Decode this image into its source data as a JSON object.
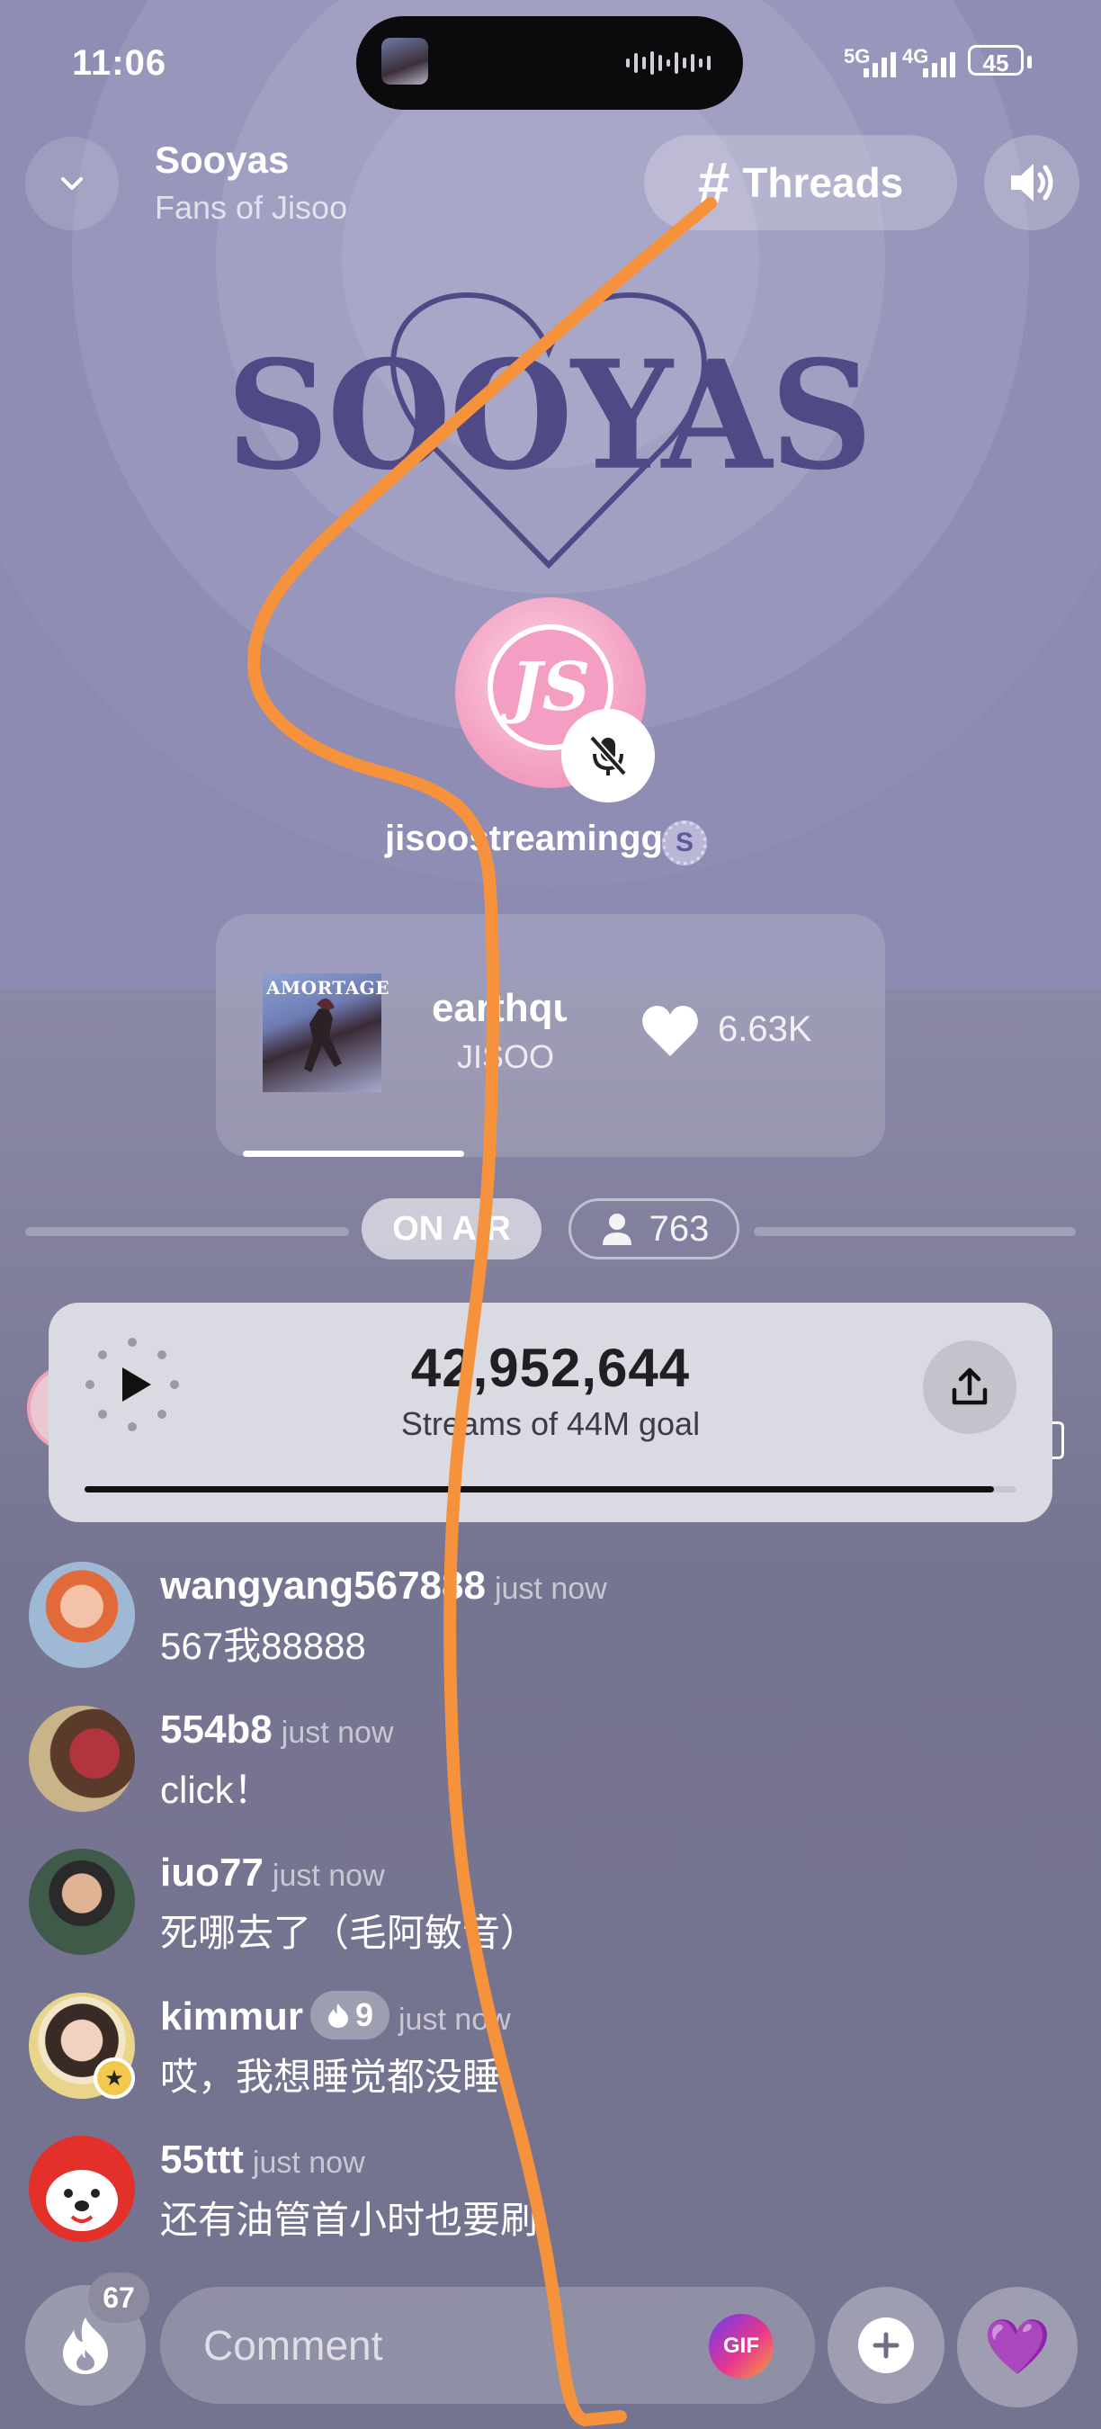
{
  "status_bar": {
    "time": "11:06",
    "net_5g": "5G",
    "net_4g": "4G",
    "battery": "45"
  },
  "header": {
    "title": "Sooyas",
    "subtitle": "Fans of Jisoo",
    "threads_label": "Threads",
    "back_icon": "chevron-down-icon",
    "speaker_icon": "speaker-icon"
  },
  "logo": {
    "text": "SOOYAS",
    "color": "#4f4a86"
  },
  "host": {
    "name": "jisoostreamingg",
    "avatar_text": "JS",
    "badge_text": "S",
    "mic_state_icon": "mic-muted-icon"
  },
  "now_playing": {
    "album_label": "AMORTAGE",
    "title": "earthquake",
    "artist": "JISOO",
    "likes": "6.63K",
    "progress": 0.33
  },
  "room_status": {
    "on_air": "ON AIR",
    "listeners": "763"
  },
  "stream_goal": {
    "count": "42,952,644",
    "label": "Streams of 44M goal",
    "progress": 0.976
  },
  "chat": [
    {
      "user": "wangyang567888",
      "time": "just now",
      "message": "567我88888",
      "streak": ""
    },
    {
      "user": "554b8",
      "time": "just now",
      "message": "click！",
      "streak": ""
    },
    {
      "user": "iuo77",
      "time": "just now",
      "message": "死哪去了（毛阿敏音）",
      "streak": ""
    },
    {
      "user": "kimmur",
      "time": "just now",
      "message": "哎，我想睡觉都没睡。",
      "streak": "9"
    },
    {
      "user": "55ttt",
      "time": "just now",
      "message": "还有油管首小时也要刷",
      "streak": ""
    }
  ],
  "bottom_bar": {
    "fire_count": "67",
    "comment_placeholder": "Comment",
    "gif_label": "GIF",
    "reaction_emoji": "💜"
  },
  "colors": {
    "background": "#7b7a98",
    "goal_card": "#dadae2",
    "annotation_stroke": "#f7923c"
  }
}
